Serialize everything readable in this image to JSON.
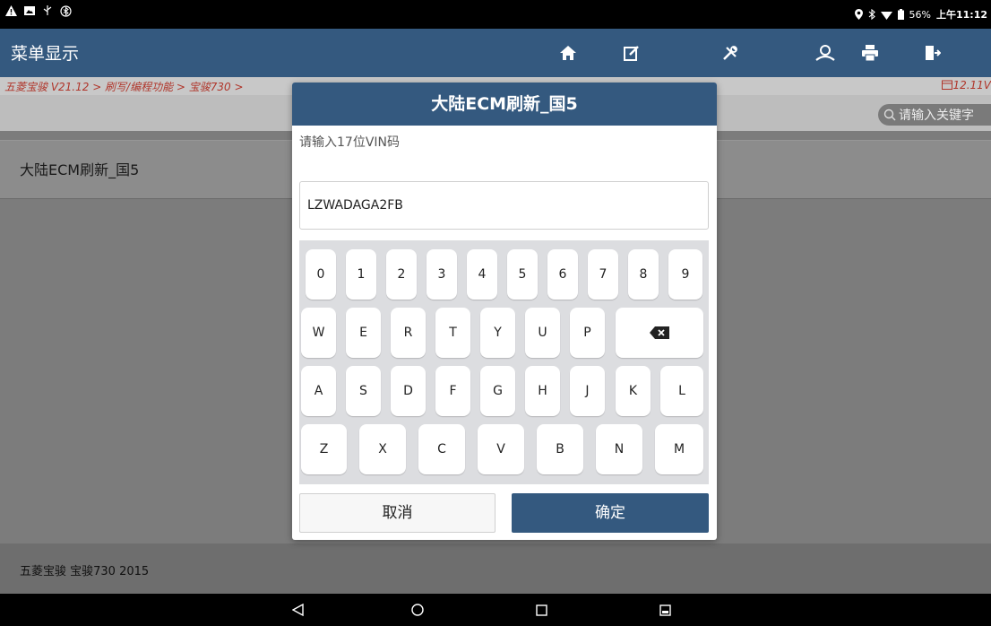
{
  "status_bar": {
    "left_icons": [
      "warning-icon",
      "image-icon",
      "usb-icon",
      "bluetooth-circle-icon"
    ],
    "battery": "56%",
    "time": "上午11:12"
  },
  "header": {
    "title": "菜单显示",
    "toolbar_icons": [
      "home-icon",
      "edit-icon",
      "tools-icon",
      "user-icon",
      "print-icon",
      "exit-icon"
    ]
  },
  "breadcrumb": {
    "path": "五菱宝骏 V21.12 > 刷写/编程功能 > 宝骏730 >",
    "version": "12.11V"
  },
  "search": {
    "placeholder": "请输入关键字"
  },
  "list": {
    "items": [
      {
        "label": "大陆ECM刷新_国5"
      }
    ]
  },
  "footer": {
    "vehicle": "五菱宝骏 宝骏730 2015"
  },
  "dialog": {
    "title": "大陆ECM刷新_国5",
    "prompt": "请输入17位VIN码",
    "input_value": "LZWADAGA2FB",
    "keys_row1": [
      "0",
      "1",
      "2",
      "3",
      "4",
      "5",
      "6",
      "7",
      "8",
      "9"
    ],
    "keys_row2": [
      "W",
      "E",
      "R",
      "T",
      "Y",
      "U",
      "P"
    ],
    "keys_row3": [
      "A",
      "S",
      "D",
      "F",
      "G",
      "H",
      "J",
      "K",
      "L"
    ],
    "keys_row4": [
      "Z",
      "X",
      "C",
      "V",
      "B",
      "N",
      "M"
    ],
    "cancel_label": "取消",
    "ok_label": "确定"
  },
  "colors": {
    "header_bg": "#34597f",
    "breadcrumb_text": "#b0352a",
    "ok_button": "#34597f"
  }
}
